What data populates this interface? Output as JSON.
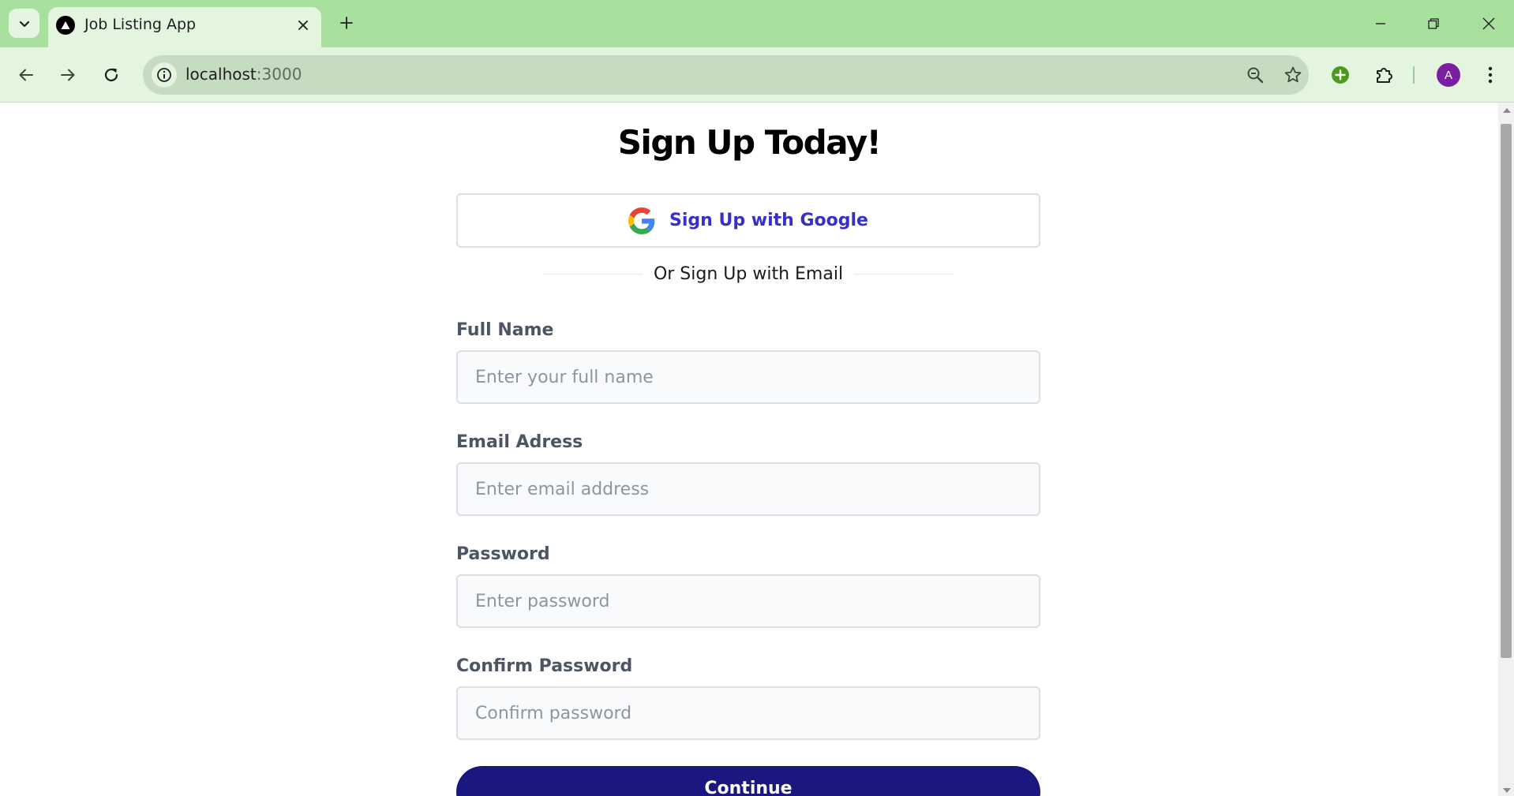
{
  "browser": {
    "tab": {
      "title": "Job Listing App"
    },
    "url": {
      "host": "localhost",
      "port": ":3000"
    },
    "profile_initial": "A"
  },
  "page": {
    "heading": "Sign Up Today!",
    "google_button": "Sign Up with Google",
    "divider_text": "Or Sign Up with Email",
    "fields": [
      {
        "label": "Full Name",
        "placeholder": "Enter your full name"
      },
      {
        "label": "Email Adress",
        "placeholder": "Enter email address"
      },
      {
        "label": "Password",
        "placeholder": "Enter password"
      },
      {
        "label": "Confirm Password",
        "placeholder": "Confirm password"
      }
    ],
    "continue_button": "Continue"
  },
  "colors": {
    "chrome_green": "#a8e09d",
    "primary": "#1a1780",
    "google_label": "#3730c8"
  }
}
